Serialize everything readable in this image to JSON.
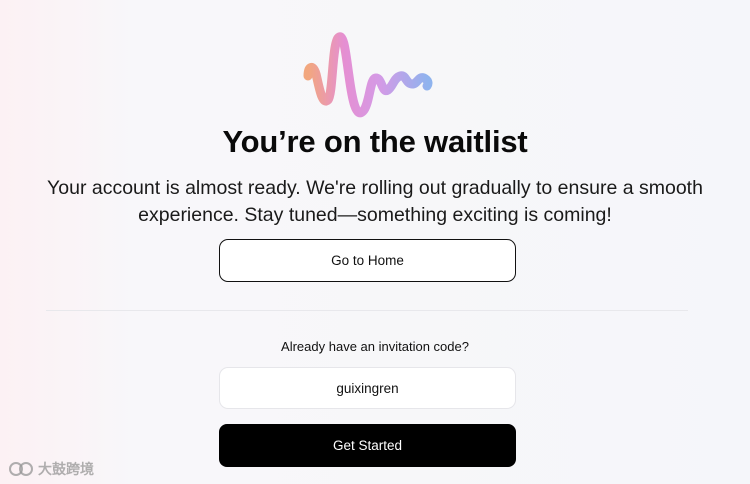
{
  "logo": {
    "icon": "wave-logo-icon",
    "colors": [
      "#f2a77e",
      "#e58fd2",
      "#d49ae6",
      "#8fb3ee"
    ]
  },
  "title": "You’re on the waitlist",
  "subtitle": "Your account is almost ready. We're rolling out gradually to ensure a smooth experience. Stay tuned—something exciting is coming!",
  "home_button": {
    "label": "Go to Home"
  },
  "invite": {
    "label": "Already have an invitation code?",
    "code_value": "guixingren",
    "submit_label": "Get Started"
  },
  "watermark": {
    "text": "大鼓跨境",
    "icon": "watermark-logo-icon"
  }
}
